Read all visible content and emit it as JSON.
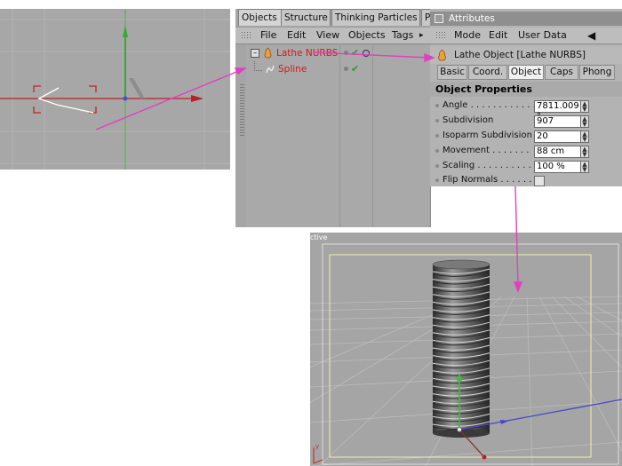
{
  "objects_tabs": [
    "Objects",
    "Structure",
    "Thinking Particles",
    "P"
  ],
  "objects_menu": [
    "File",
    "Edit",
    "View",
    "Objects",
    "Tags",
    "▸"
  ],
  "object_tree": [
    {
      "name": "Lathe NURBS",
      "color": "#d81818"
    },
    {
      "name": "Spline",
      "color": "#d81818"
    }
  ],
  "attributes": {
    "title": "Attributes",
    "menu": [
      "Mode",
      "Edit",
      "User Data",
      "◀"
    ],
    "object_header": "Lathe Object [Lathe NURBS]",
    "tabs": [
      "Basic",
      "Coord.",
      "Object",
      "Caps",
      "Phong"
    ],
    "active_tab": "Object",
    "section_title": "Object Properties",
    "properties": [
      {
        "label": "Angle . . . . . . . . . . . . .",
        "value": "7811.009 °"
      },
      {
        "label": "Subdivision",
        "value": "907"
      },
      {
        "label": "Isoparm Subdivision",
        "value": "20"
      },
      {
        "label": "Movement . . . . . . .",
        "value": "88 cm"
      },
      {
        "label": "Scaling . . . . . . . . . .",
        "value": "100 %"
      },
      {
        "label": "Flip Normals . . . . . .",
        "value": ""
      }
    ]
  },
  "perspective_label": "ctive",
  "colors": {
    "arrow": "#e23fc3",
    "axis_x": "#d03232",
    "axis_y": "#38c238",
    "axis_z": "#4646cc",
    "safe_frame": "#f0f0a8"
  }
}
